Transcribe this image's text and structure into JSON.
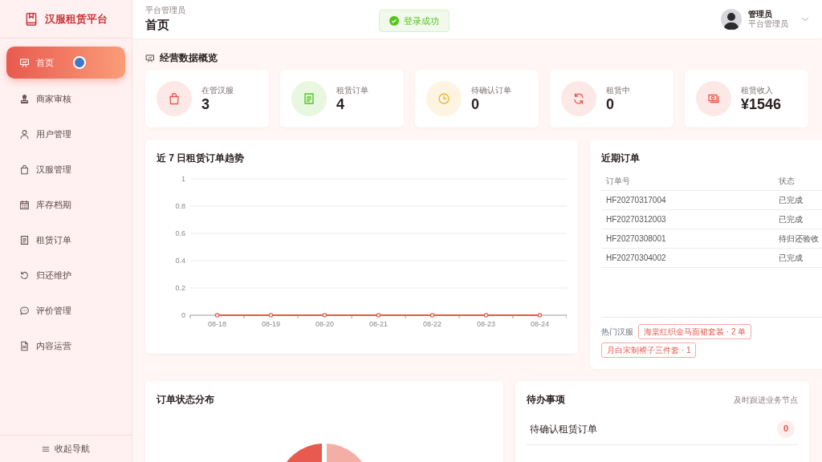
{
  "brand": {
    "title": "汉服租赁平台"
  },
  "sidebar": {
    "items": [
      {
        "label": "首页",
        "selected": true
      },
      {
        "label": "商家审核",
        "selected": false
      },
      {
        "label": "用户管理",
        "selected": false
      },
      {
        "label": "汉服管理",
        "selected": false
      },
      {
        "label": "库存档期",
        "selected": false
      },
      {
        "label": "租赁订单",
        "selected": false
      },
      {
        "label": "归还维护",
        "selected": false
      },
      {
        "label": "评价管理",
        "selected": false
      },
      {
        "label": "内容运营",
        "selected": false
      }
    ],
    "collapse": "收起导航"
  },
  "header": {
    "subtitle": "平台管理员",
    "title": "首页",
    "toast": "登录成功",
    "user": {
      "name": "管理员",
      "role": "平台管理员"
    }
  },
  "overview": {
    "title": "经营数据概览"
  },
  "stats": [
    {
      "label": "在管汉服",
      "value": "3",
      "color": "#e8574a"
    },
    {
      "label": "租赁订单",
      "value": "4",
      "color": "#52c41a"
    },
    {
      "label": "待确认订单",
      "value": "0",
      "color": "#f0b429"
    },
    {
      "label": "租赁中",
      "value": "0",
      "color": "#e8574a"
    },
    {
      "label": "租赁收入",
      "value": "¥1546",
      "color": "#e8574a"
    }
  ],
  "trend": {
    "title": "近 7 日租赁订单趋势",
    "chart_data": {
      "type": "line",
      "categories": [
        "08-18",
        "08-19",
        "08-20",
        "08-21",
        "08-22",
        "08-23",
        "08-24"
      ],
      "grid": true,
      "series": [
        {
          "color": "#e8574a",
          "marker": "circle",
          "values": [
            0,
            0,
            0,
            0,
            0,
            0,
            0
          ]
        }
      ],
      "ylim": [
        0,
        1
      ],
      "yticks": [
        0,
        {
          "value": 0.2,
          "label": "0.2"
        },
        {
          "value": 0.4,
          "label": "0.4"
        },
        {
          "value": 0.6,
          "label": "0.6"
        },
        {
          "value": 0.8,
          "label": "0.8"
        },
        1
      ]
    }
  },
  "recent_orders": {
    "title": "近期订单",
    "columns": [
      "订单号",
      "状态"
    ],
    "rows": [
      [
        "HF20270317004",
        "已完成"
      ],
      [
        "HF20270312003",
        "已完成"
      ],
      [
        "HF20270308001",
        "待归还验收"
      ],
      [
        "HF20270304002",
        "已完成"
      ]
    ],
    "hot_label": "热门汉服",
    "hot_tags": [
      "海棠红织金马面裙套装 · 2 单",
      "月白宋制褙子三件套 · 1"
    ]
  },
  "status_dist": {
    "title": "订单状态分布"
  },
  "todo": {
    "title": "待办事项",
    "hint": "及时跟进业务节点",
    "items": [
      {
        "label": "待确认租赁订单",
        "count": "0"
      }
    ]
  }
}
